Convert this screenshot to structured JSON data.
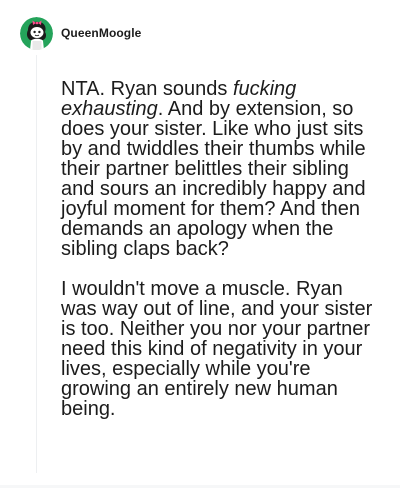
{
  "comment": {
    "author": "QueenMoogle",
    "avatar_icon": "reddit-snoo-avatar-icon",
    "colors": {
      "avatar_background": "#24a35a",
      "text": "#1c1c1c",
      "thread_line": "#edeff1"
    },
    "paragraph_1": {
      "before_emphasis": "NTA. Ryan sounds ",
      "emphasis": "fucking exhausting",
      "after_emphasis": ". And by extension, so does your sister. Like who just sits by and twiddles their thumbs while their partner belittles their sibling and sours an incredibly happy and joyful moment for them? And then demands an apology when the sibling claps back?"
    },
    "paragraph_2": "I wouldn't move a muscle. Ryan was way out of line, and your sister is too. Neither you nor your partner need this kind of negativity in your lives, especially while you're growing an entirely new human being."
  }
}
